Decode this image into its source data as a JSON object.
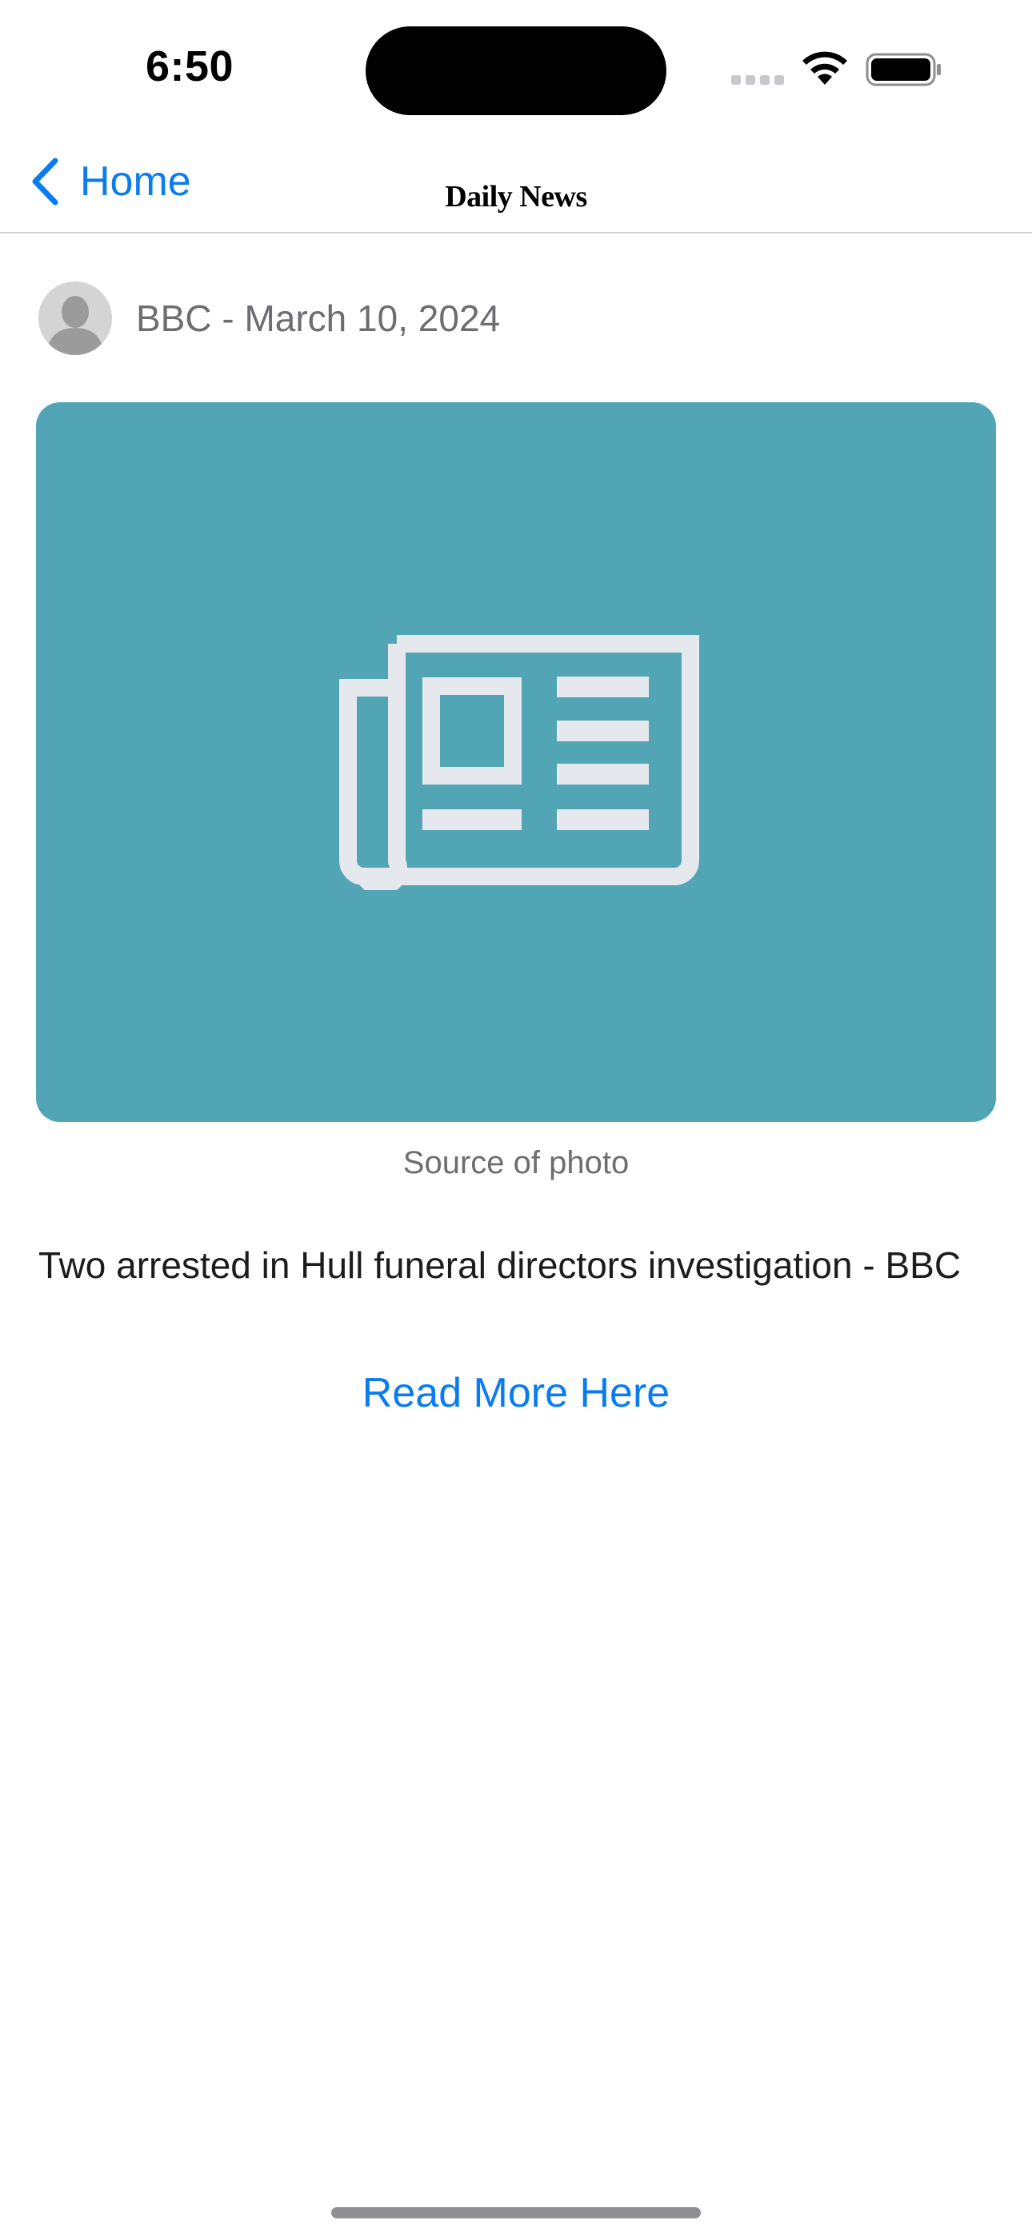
{
  "status_bar": {
    "time": "6:50"
  },
  "nav": {
    "back_label": "Home",
    "title": "Daily News"
  },
  "article": {
    "byline": "BBC - March 10, 2024",
    "photo_icon": "newspaper-icon",
    "photo_background": "#52a5b5",
    "photo_caption": "Source of photo",
    "headline": "Two arrested in Hull funeral directors investigation - BBC",
    "read_more_label": "Read More Here"
  },
  "colors": {
    "accent": "#0a7cf0",
    "secondary_text": "#6d6d72"
  }
}
